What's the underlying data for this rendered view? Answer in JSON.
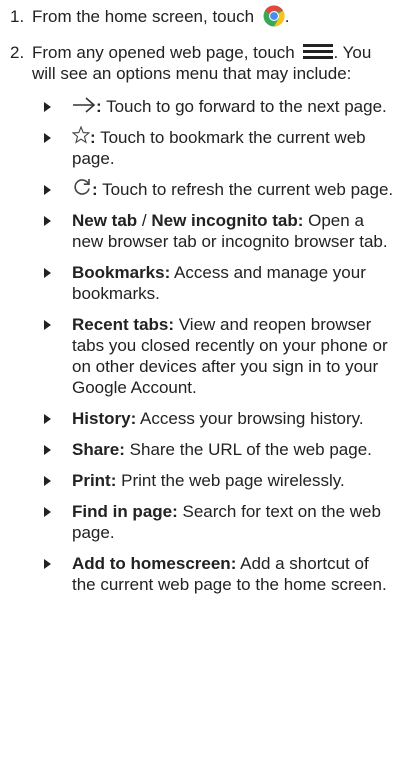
{
  "steps": [
    {
      "number": "1.",
      "text_before_icon": "From the home screen, touch",
      "icon": "chrome-icon",
      "text_after_icon": "."
    },
    {
      "number": "2.",
      "text_before_icon": "From any opened web page, touch",
      "icon": "menu-icon",
      "text_after_icon": ". You will see an options menu that may include:"
    }
  ],
  "options": [
    {
      "icon": "forward-arrow-icon",
      "label": ":",
      "desc": " Touch to go forward to the next page."
    },
    {
      "icon": "star-icon",
      "label": ":",
      "desc": " Touch to bookmark the current web page."
    },
    {
      "icon": "refresh-icon",
      "label": ":",
      "desc": " Touch to refresh the current web page."
    },
    {
      "label_a": "New tab",
      "sep": " / ",
      "label_b": "New incognito tab:",
      "desc": " Open a new browser tab or incognito browser tab."
    },
    {
      "label": "Bookmarks:",
      "desc": " Access and manage your bookmarks."
    },
    {
      "label": "Recent tabs:",
      "desc": " View and reopen browser tabs you closed recently on your phone or on other devices after you sign in to your Google Account."
    },
    {
      "label": "History:",
      "desc": " Access your browsing history."
    },
    {
      "label": "Share:",
      "desc": " Share the URL of the web page."
    },
    {
      "label": "Print:",
      "desc": " Print the web page wirelessly."
    },
    {
      "label": "Find in page:",
      "desc": " Search for text on the web page."
    },
    {
      "label": "Add to homescreen:",
      "desc": " Add a shortcut of the current web page to the home screen."
    }
  ],
  "colors": {
    "text": "#222222",
    "chrome_red": "#e2473b",
    "chrome_yellow": "#f5c518",
    "chrome_green": "#3aa757",
    "chrome_blue": "#4a8af4"
  }
}
